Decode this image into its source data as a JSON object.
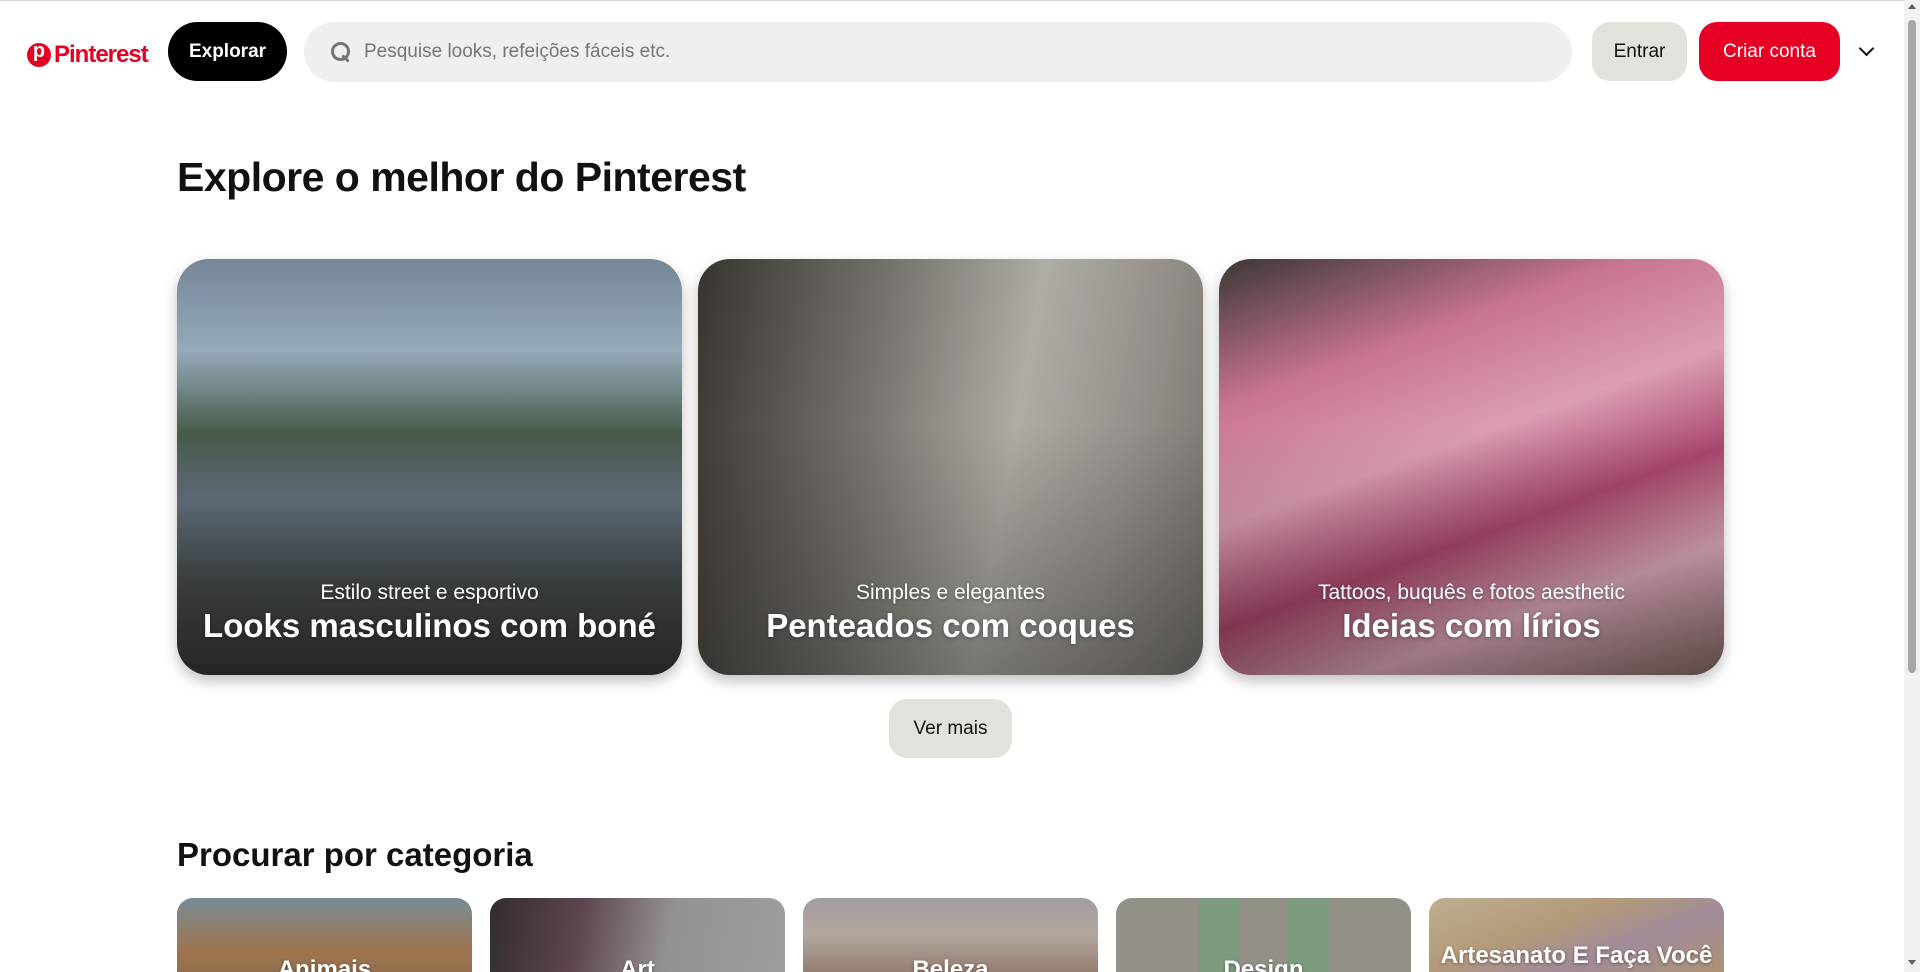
{
  "header": {
    "logo_text": "Pinterest",
    "explore_label": "Explorar",
    "search_placeholder": "Pesquise looks, refeições fáceis etc.",
    "login_label": "Entrar",
    "signup_label": "Criar conta",
    "brand_color": "#e60023"
  },
  "main": {
    "title": "Explore o melhor do Pinterest",
    "cards": [
      {
        "subtitle": "Estilo street e esportivo",
        "title": "Looks masculinos com boné"
      },
      {
        "subtitle": "Simples e elegantes",
        "title": "Penteados com coques"
      },
      {
        "subtitle": "Tattoos, buquês e fotos aesthetic",
        "title": "Ideias com lírios"
      }
    ],
    "see_more_label": "Ver mais"
  },
  "categories": {
    "title": "Procurar por categoria",
    "items": [
      {
        "label": "Animais"
      },
      {
        "label": "Art"
      },
      {
        "label": "Beleza"
      },
      {
        "label": "Design"
      },
      {
        "label": "Artesanato E Faça Você"
      }
    ]
  },
  "icons": {
    "logo": "pinterest-logo-icon",
    "search": "search-icon",
    "menu": "chevron-down-icon"
  }
}
